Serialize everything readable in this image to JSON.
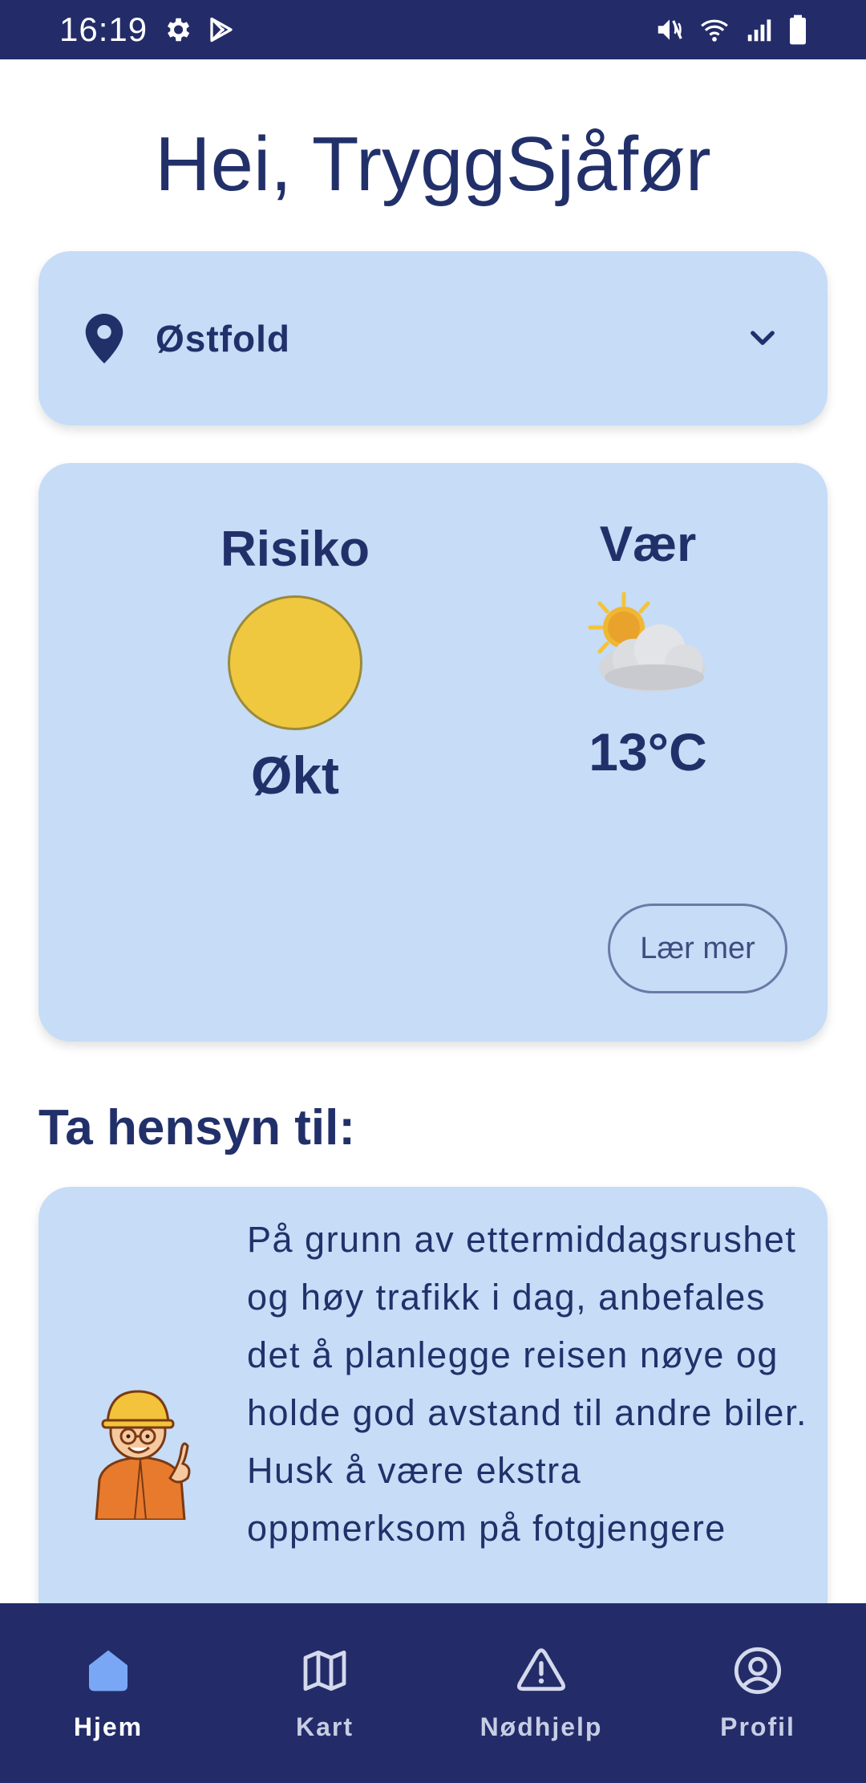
{
  "status_bar": {
    "time": "16:19"
  },
  "greeting": "Hei, TryggSjåfør",
  "region_selector": {
    "value": "Østfold"
  },
  "risk_card": {
    "risk_title": "Risiko",
    "risk_value": "Økt",
    "risk_color": "#f0c840",
    "weather_title": "Vær",
    "weather_icon": "sun-behind-cloud",
    "temperature": "13°C",
    "learn_more_label": "Lær mer"
  },
  "tips": {
    "section_title": "Ta hensyn til:",
    "text": "På grunn av ettermiddagsrushet og høy trafikk i dag, anbefales det å planlegge reisen nøye og holde god avstand til andre biler. Husk å være ekstra oppmerksom på fotgjengere"
  },
  "bottom_nav": {
    "items": [
      {
        "label": "Hjem",
        "icon": "home-icon",
        "active": true
      },
      {
        "label": "Kart",
        "icon": "map-icon",
        "active": false
      },
      {
        "label": "Nødhjelp",
        "icon": "alert-icon",
        "active": false
      },
      {
        "label": "Profil",
        "icon": "profile-icon",
        "active": false
      }
    ]
  },
  "colors": {
    "primary_navy": "#232c69",
    "card_blue": "#c6dcf7",
    "active_nav_icon": "#7aa7f5"
  }
}
